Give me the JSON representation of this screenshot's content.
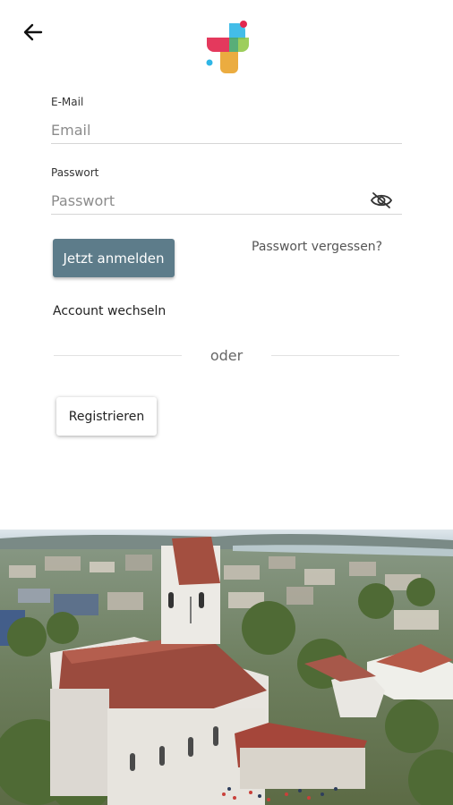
{
  "header": {
    "back_icon": "arrow-left-icon",
    "logo": "colorful-cross-logo"
  },
  "form": {
    "email_label": "E-Mail",
    "email_placeholder": "Email",
    "password_label": "Passwort",
    "password_placeholder": "Passwort",
    "visibility_icon": "eye-off-icon",
    "login_label": "Jetzt anmelden",
    "forgot_label": "Passwort vergessen?",
    "switch_account_label": "Account wechseln",
    "divider_label": "oder",
    "register_label": "Registrieren"
  },
  "colors": {
    "primary_button": "#5d7c8a",
    "logo_red": "#e2284f",
    "logo_cyan": "#2fb6e6",
    "logo_orange": "#e9a32b"
  }
}
